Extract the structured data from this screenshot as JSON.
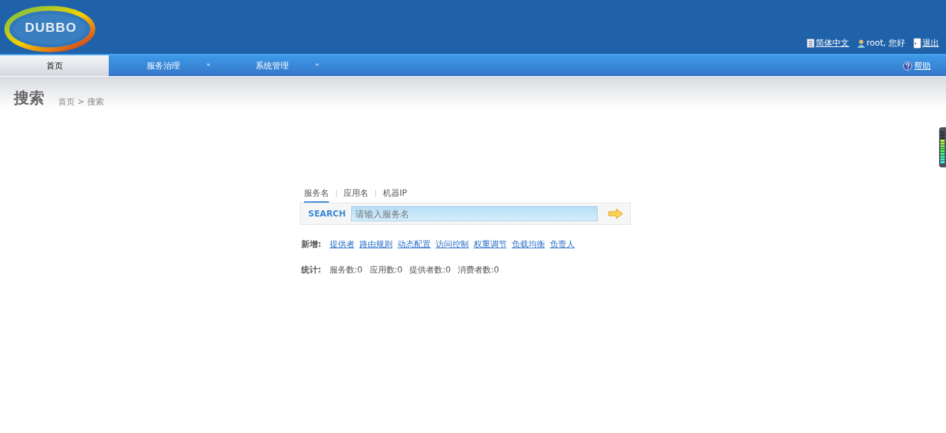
{
  "header": {
    "logo": "DUBBO",
    "links": [
      {
        "kind": "language",
        "label": "简体中文"
      },
      {
        "kind": "user",
        "label": "root, 您好"
      },
      {
        "kind": "logout",
        "label": "退出"
      }
    ]
  },
  "nav": {
    "items": [
      {
        "label": "首页",
        "selected": true,
        "dropdown": false
      },
      {
        "label": "服务治理",
        "selected": false,
        "dropdown": true
      },
      {
        "label": "系统管理",
        "selected": false,
        "dropdown": true
      }
    ],
    "help": "帮助"
  },
  "page": {
    "title": "搜索",
    "breadcrumb": "首页 > 搜索"
  },
  "search": {
    "tabs": [
      {
        "label": "服务名",
        "selected": true
      },
      {
        "label": "应用名",
        "selected": false
      },
      {
        "label": "机器IP",
        "selected": false
      }
    ],
    "label": "SEARCH",
    "placeholder": "请输入服务名"
  },
  "add": {
    "label": "新增:",
    "links": [
      "提供者",
      "路由规则",
      "动态配置",
      "访问控制",
      "权重调节",
      "负载均衡",
      "负责人"
    ]
  },
  "stats": {
    "label": "统计:",
    "items": [
      "服务数:0",
      "应用数:0",
      "提供者数:0",
      "消费者数:0"
    ]
  }
}
